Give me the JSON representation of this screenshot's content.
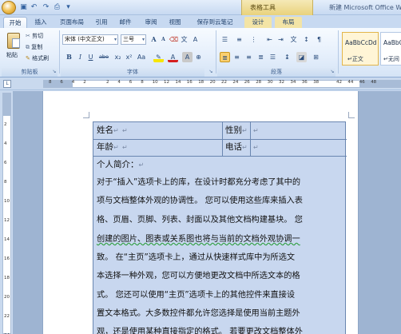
{
  "titlebar": {
    "contextual_label": "表格工具",
    "app_title": "新建 Microsoft Office Wo"
  },
  "tabs": [
    {
      "label": "开始",
      "active": true
    },
    {
      "label": "插入"
    },
    {
      "label": "页面布局"
    },
    {
      "label": "引用"
    },
    {
      "label": "邮件"
    },
    {
      "label": "审阅"
    },
    {
      "label": "视图"
    },
    {
      "label": "保存到云笔记"
    },
    {
      "label": "设计"
    },
    {
      "label": "布局"
    }
  ],
  "clipboard": {
    "paste": "粘贴",
    "cut": "剪切",
    "copy": "复制",
    "format_painter": "格式刷",
    "group_label": "剪贴板"
  },
  "font": {
    "font_name": "宋体 (中文正文)",
    "font_size": "三号",
    "grow": "A",
    "shrink": "A",
    "change_case": "Aa",
    "bold": "B",
    "italic": "I",
    "underline": "U",
    "strike": "abe",
    "subscript": "x₂",
    "superscript": "x²",
    "group_label": "字体"
  },
  "paragraph": {
    "group_label": "段落"
  },
  "styles": {
    "items": [
      {
        "sample": "AaBbCcDd",
        "name": "↵正文"
      },
      {
        "sample": "AaBbC",
        "name": "↵无间"
      }
    ]
  },
  "ruler": {
    "numbers": [
      "8",
      "6",
      "4",
      "2",
      "",
      "2",
      "4",
      "6",
      "8",
      "10",
      "12",
      "14",
      "16",
      "18",
      "20",
      "22",
      "24",
      "26",
      "28",
      "30",
      "32",
      "34",
      "36",
      "38",
      "",
      "42",
      "44",
      "46",
      "48"
    ]
  },
  "vruler": {
    "numbers": [
      "2",
      "4",
      "6",
      "8",
      "10",
      "12",
      "14",
      "16",
      "18",
      "20",
      "22",
      "24"
    ]
  },
  "document": {
    "row1": {
      "name_label": "姓名",
      "gender_label": "性别"
    },
    "row2": {
      "age_label": "年龄",
      "phone_label": "电话"
    },
    "intro_label": "个人简介：",
    "paragraph_mark": "↵",
    "body_lines": [
      "对于“插入”选项卡上的库，在设计时都充分考虑了其中的",
      "项与文档整体外观的协调性。 您可以使用这些库来插入表",
      "格、页眉、页脚、列表、封面以及其他文档构建基块。 您",
      "创建的图片、图表或关系图也将与当前的文档外观协调一",
      "致。 在“主页”选项卡上，通过从快速样式库中为所选文",
      "本选择一种外观，您可以方便地更改文档中所选文本的格",
      "式。 您还可以使用“主页”选项卡上的其他控件来直接设",
      "置文本格式。大多数控件都允许您选择是使用当前主题外",
      "观，还是使用某种直接指定的格式。 若要更改文档整体外"
    ]
  }
}
